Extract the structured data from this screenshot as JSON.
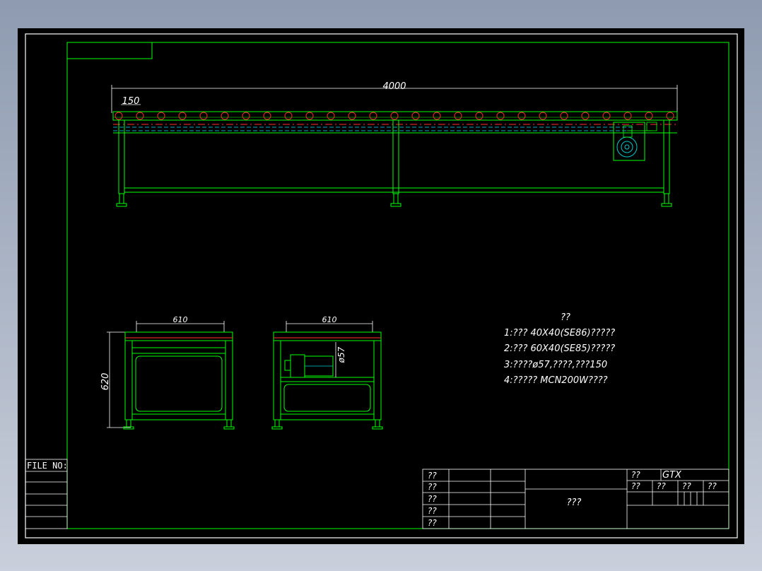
{
  "drawing": {
    "dimensions": {
      "overall_length": "4000",
      "roller_pitch": "150",
      "width_left_view": "610",
      "width_right_view": "610",
      "height": "620",
      "roller_diameter": "ø57"
    },
    "notes": {
      "heading": "??",
      "lines": [
        "1:??? 40X40(SE86)?????",
        "2:??? 60X40(SE85)?????",
        "3:????ø57,????,???150",
        "4:????? MCN200W????"
      ]
    },
    "file_no_label": "FILE NO:",
    "title_block": {
      "row_labels": [
        "??",
        "??",
        "??",
        "??",
        "??"
      ],
      "drawing_name": "???",
      "material_label": "??",
      "material_value": "GTX",
      "scale_labels": [
        "??",
        "??",
        "??",
        "??"
      ]
    }
  },
  "colors": {
    "frame": "#00ff00",
    "roller": "#ff3030",
    "centerline": "#ff3030",
    "hidden": "#00e5ff",
    "motor": "#00c8c8",
    "text": "#ffffff"
  }
}
